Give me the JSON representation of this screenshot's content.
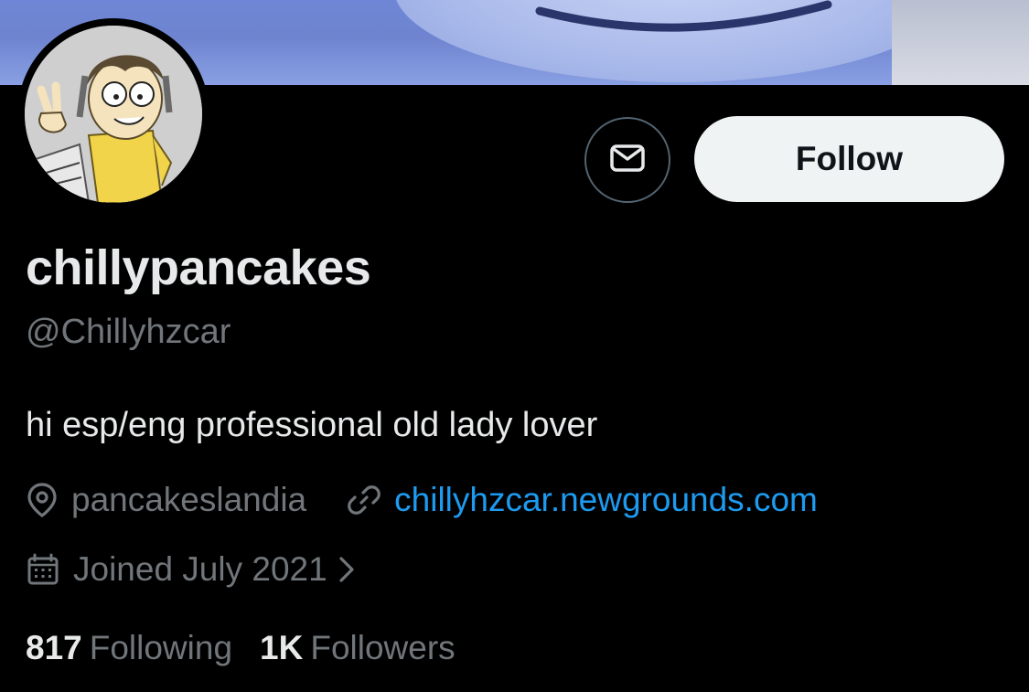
{
  "profile": {
    "display_name": "chillypancakes",
    "handle": "@Chillyhzcar",
    "bio": "hi esp/eng professional old lady lover",
    "location": "pancakeslandia",
    "website": "chillyhzcar.newgrounds.com",
    "joined": "Joined July 2021"
  },
  "actions": {
    "message_icon": "envelope-icon",
    "follow_label": "Follow"
  },
  "stats": {
    "following_count": "817",
    "following_label": "Following",
    "followers_count": "1K",
    "followers_label": "Followers"
  },
  "icons": {
    "location": "map-pin-icon",
    "link": "link-icon",
    "joined": "calendar-icon",
    "joined_more": "chevron-right-icon"
  },
  "colors": {
    "background": "#000000",
    "primary_text": "#e7e9ea",
    "secondary_text": "#71767b",
    "link": "#1d9bf0",
    "follow_button_bg": "#eff3f4"
  }
}
